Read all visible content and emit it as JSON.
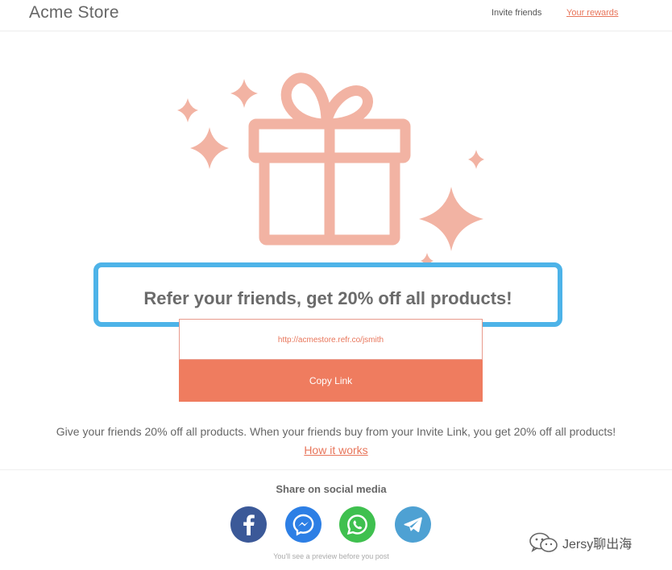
{
  "header": {
    "brand": "Acme Store",
    "nav": {
      "invite_friends": "Invite friends",
      "your_rewards": "Your rewards"
    }
  },
  "hero": {
    "illustration": "gift-box-with-sparkles",
    "accent_color": "#f2b3a3"
  },
  "referral": {
    "headline": "Refer your friends, get 20% off all products!",
    "invite_link": "http://acmestore.refr.co/jsmith",
    "copy_button_label": "Copy Link",
    "description": "Give your friends 20% off all products. When your friends buy from your Invite Link, you get 20% off all products!",
    "how_it_works_label": "How it works"
  },
  "share": {
    "title": "Share on social media",
    "networks": [
      {
        "name": "facebook",
        "icon": "facebook-icon",
        "color": "#3b5998"
      },
      {
        "name": "messenger",
        "icon": "messenger-icon",
        "color": "#2d7fe5"
      },
      {
        "name": "whatsapp",
        "icon": "whatsapp-icon",
        "color": "#3fc04f"
      },
      {
        "name": "telegram",
        "icon": "telegram-icon",
        "color": "#4ea1d3"
      }
    ],
    "preview_note": "You'll see a preview before you post"
  },
  "watermark": {
    "text": "Jersy聊出海",
    "icon": "wechat-icon"
  },
  "colors": {
    "accent": "#ef7c5f",
    "highlight_border": "#4db3e8"
  }
}
